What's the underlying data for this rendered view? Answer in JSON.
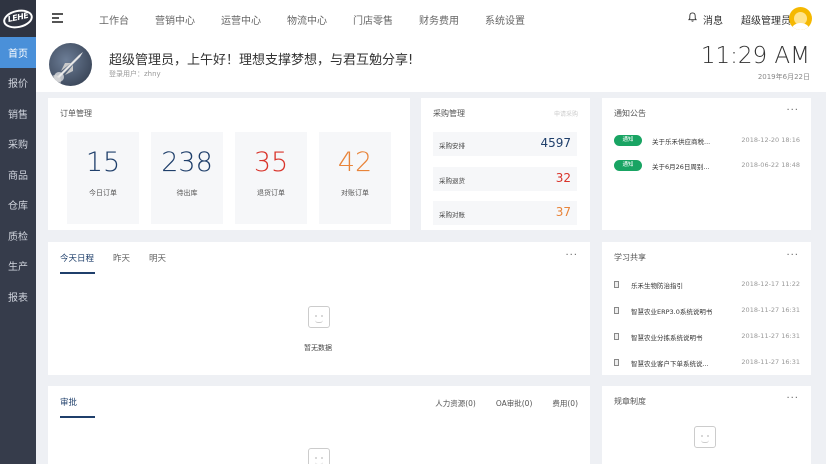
{
  "logo_text": "LEHE",
  "sidebar": {
    "items": [
      {
        "label": "首页"
      },
      {
        "label": "报价"
      },
      {
        "label": "销售"
      },
      {
        "label": "采购"
      },
      {
        "label": "商品"
      },
      {
        "label": "仓库"
      },
      {
        "label": "质检"
      },
      {
        "label": "生产"
      },
      {
        "label": "报表"
      }
    ]
  },
  "topbar": {
    "nav": [
      "工作台",
      "营销中心",
      "运营中心",
      "物流中心",
      "门店零售",
      "财务费用",
      "系统设置"
    ],
    "message": "消息",
    "username": "超级管理员"
  },
  "welcome": {
    "greeting": "超级管理员，上午好！理想支撑梦想，与君互勉分享!",
    "login_user": "登录用户：zhny",
    "time": "11:29 AM",
    "date": "2019年6月22日"
  },
  "orders": {
    "title": "订单管理",
    "stats": [
      {
        "value": "15",
        "label": "今日订单",
        "color": "#1f3f6b"
      },
      {
        "value": "238",
        "label": "待出库",
        "color": "#1f3f6b"
      },
      {
        "value": "35",
        "label": "退货订单",
        "color": "#d9342b"
      },
      {
        "value": "42",
        "label": "对账订单",
        "color": "#e8843a"
      }
    ]
  },
  "purchase": {
    "title": "采购管理",
    "hint": "申请采购",
    "rows": [
      {
        "label": "采购安排",
        "value": "4597",
        "color": "#1f3f6b"
      },
      {
        "label": "采购退货",
        "value": "32",
        "color": "#d9342b"
      },
      {
        "label": "采购对账",
        "value": "37",
        "color": "#e8843a"
      }
    ]
  },
  "notices": {
    "title": "通知公告",
    "more": "···",
    "items": [
      {
        "badge": "通知",
        "text": "关于乐禾供应商税...",
        "time": "2018-12-20 18:16"
      },
      {
        "badge": "通知",
        "text": "关于6月26日周别...",
        "time": "2018-06-22 18:48"
      }
    ]
  },
  "schedule": {
    "tabs": [
      "今天日程",
      "昨天",
      "明天"
    ],
    "more": "···",
    "empty": "暂无数据"
  },
  "study": {
    "title": "学习共享",
    "more": "···",
    "items": [
      {
        "text": "乐禾生物防治指引",
        "time": "2018-12-17 11:22"
      },
      {
        "text": "智慧农业ERP3.0系统说明书",
        "time": "2018-11-27 16:31"
      },
      {
        "text": "智慧农业分拣系统说明书",
        "time": "2018-11-27 16:31"
      },
      {
        "text": "智慧农业客户下单系统说...",
        "time": "2018-11-27 16:31"
      }
    ]
  },
  "approval": {
    "tab": "审批",
    "links": [
      "人力资源(0)",
      "OA审批(0)",
      "费用(0)"
    ]
  },
  "rules": {
    "title": "规章制度",
    "more": "···"
  }
}
